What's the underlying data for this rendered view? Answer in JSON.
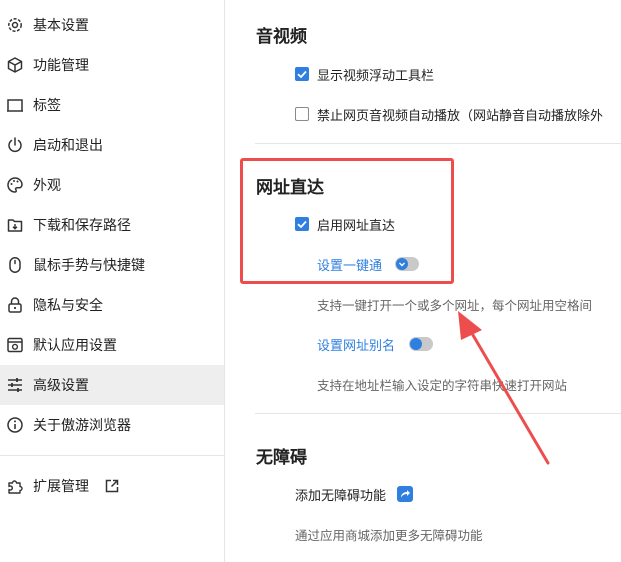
{
  "colors": {
    "accent": "#2f7fe0",
    "annotation": "#ee4d4d",
    "active_bg": "#eeeeee"
  },
  "sidebar": {
    "items": [
      {
        "label": "基本设置",
        "icon": "gear-icon"
      },
      {
        "label": "功能管理",
        "icon": "cube-icon"
      },
      {
        "label": "标签",
        "icon": "tab-icon"
      },
      {
        "label": "启动和退出",
        "icon": "power-icon"
      },
      {
        "label": "外观",
        "icon": "palette-icon"
      },
      {
        "label": "下载和保存路径",
        "icon": "download-icon"
      },
      {
        "label": "鼠标手势与快捷键",
        "icon": "mouse-icon"
      },
      {
        "label": "隐私与安全",
        "icon": "lock-icon"
      },
      {
        "label": "默认应用设置",
        "icon": "default-app-icon"
      },
      {
        "label": "高级设置",
        "icon": "sliders-icon",
        "active": true
      },
      {
        "label": "关于傲游浏览器",
        "icon": "info-icon"
      }
    ],
    "extensions": {
      "label": "扩展管理",
      "icon": "puzzle-icon",
      "link_icon": "external-link-icon"
    }
  },
  "main": {
    "av": {
      "title": "音视频",
      "options": [
        {
          "label": "显示视频浮动工具栏",
          "checked": true
        },
        {
          "label": "禁止网页音视频自动播放（网站静音自动播放除外",
          "checked": false
        }
      ]
    },
    "direct": {
      "title": "网址直达",
      "enable_label": "启用网址直达",
      "enabled": true,
      "one_key_link": "设置一键通",
      "one_key_desc": "支持一键打开一个或多个网址，每个网址用空格间",
      "alias_link": "设置网址别名",
      "alias_desc": "支持在地址栏输入设定的字符串快速打开网站"
    },
    "a11y": {
      "title": "无障碍",
      "add_label": "添加无障碍功能",
      "desc": "通过应用商城添加更多无障碍功能"
    }
  }
}
